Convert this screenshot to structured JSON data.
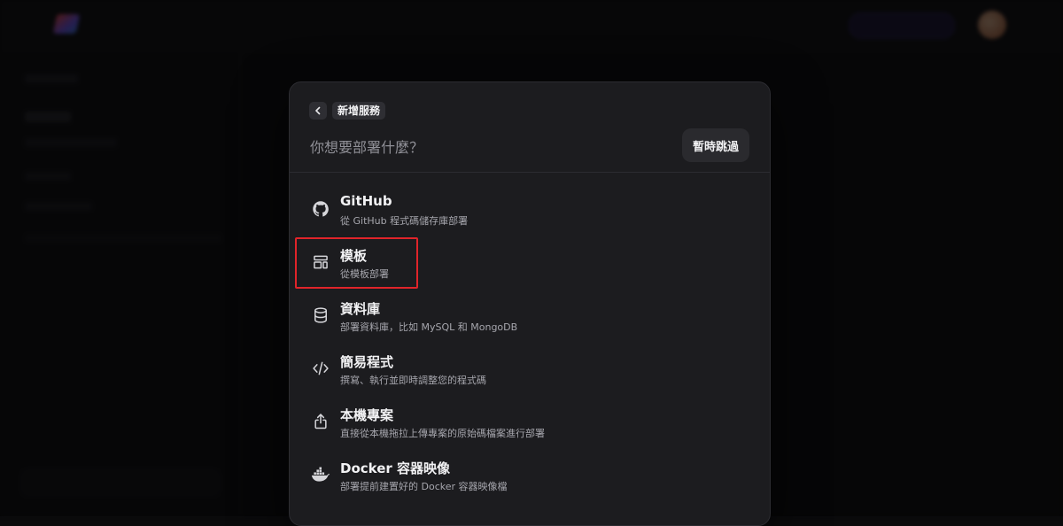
{
  "modal": {
    "breadcrumb": "新增服務",
    "question": "你想要部署什麼？",
    "skip_label": "暫時跳過",
    "options": [
      {
        "title": "GitHub",
        "description": "從 GitHub 程式碼儲存庫部署",
        "icon": "github-icon"
      },
      {
        "title": "模板",
        "description": "從模板部署",
        "icon": "template-icon"
      },
      {
        "title": "資料庫",
        "description": "部署資料庫，比如 MySQL 和 MongoDB",
        "icon": "database-icon"
      },
      {
        "title": "簡易程式",
        "description": "撰寫、執行並即時調整您的程式碼",
        "icon": "code-icon"
      },
      {
        "title": "本機專案",
        "description": "直接從本機拖拉上傳專案的原始碼檔案進行部署",
        "icon": "upload-icon"
      },
      {
        "title": "Docker 容器映像",
        "description": "部署提前建置好的 Docker 容器映像檔",
        "icon": "docker-icon"
      }
    ]
  },
  "colors": {
    "modal_bg": "#1c1c1f",
    "highlight": "#e0242a",
    "accent_logo": "#7a5cff"
  }
}
